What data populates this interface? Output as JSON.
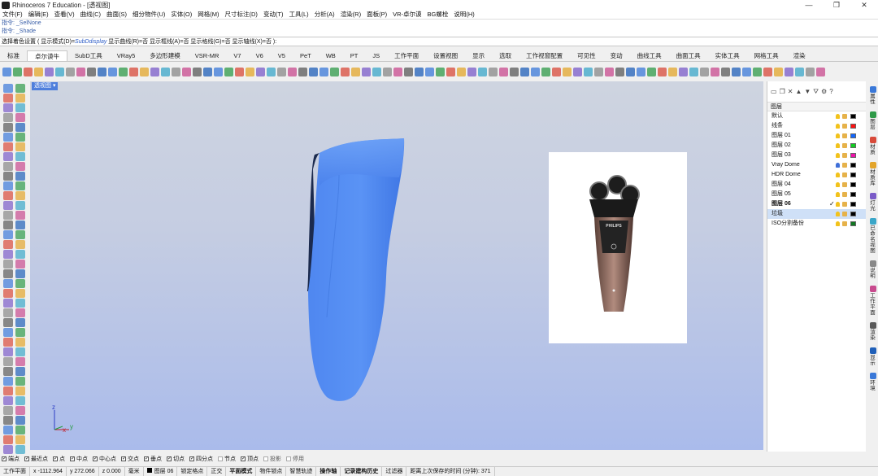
{
  "window": {
    "title": "Rhinoceros 7 Education - [透视图]",
    "minimize": "—",
    "maximize": "❐",
    "close": "✕"
  },
  "menu": [
    "文件(F)",
    "编辑(E)",
    "查看(V)",
    "曲线(C)",
    "曲面(S)",
    "细分物件(U)",
    "实体(O)",
    "网格(M)",
    "尺寸标注(D)",
    "变动(T)",
    "工具(L)",
    "分析(A)",
    "渲染(R)",
    "面板(P)",
    "VR-卓尔谟",
    "BG螺栓",
    "说明(H)"
  ],
  "command_history": [
    "指令: _SelNone",
    "指令: _Shade"
  ],
  "command_prompt": {
    "prefix": "选择着色设置 ( 显示模式(D)=",
    "mode": "SubDdisplay",
    "rest": " 显示曲线(R)=否 显示框线(A)=否 显示格线(G)=否 显示轴线(X)=否 ):"
  },
  "tabs": [
    "标准",
    "卓尔谟牛",
    "SubD工具",
    "VRay5",
    "多边形建模",
    "VSR-MR",
    "V7",
    "V6",
    "V5",
    "PeT",
    "WB",
    "PT",
    "JS",
    "工作平面",
    "设置视图",
    "显示",
    "选取",
    "工作视窗配置",
    "可见性",
    "变动",
    "曲线工具",
    "曲面工具",
    "实体工具",
    "网格工具",
    "渲染"
  ],
  "active_tab": "卓尔谟牛",
  "viewport": {
    "label": "透视图 ▾",
    "axis_x": "x",
    "axis_y": "y",
    "axis_z": "z"
  },
  "reference_image": {
    "brand": "PHILIPS"
  },
  "layers_panel": {
    "header": "图层",
    "toolbar_icons": [
      "new-layer-icon",
      "copy-icon",
      "delete-icon",
      "up-icon",
      "down-icon",
      "filter-icon",
      "tools-icon",
      "help-icon"
    ],
    "rows": [
      {
        "name": "默认",
        "color": "#000000",
        "bold": false,
        "selected": false,
        "current": false,
        "bulb": "#f2c21b"
      },
      {
        "name": "线条",
        "color": "#ff1111",
        "bold": false,
        "selected": false,
        "current": false,
        "bulb": "#f2c21b"
      },
      {
        "name": "图层 01",
        "color": "#1166ff",
        "bold": false,
        "selected": false,
        "current": false,
        "bulb": "#f2c21b"
      },
      {
        "name": "图层 02",
        "color": "#11cc22",
        "bold": false,
        "selected": false,
        "current": false,
        "bulb": "#f2c21b"
      },
      {
        "name": "图层 03",
        "color": "#ee11aa",
        "bold": false,
        "selected": false,
        "current": false,
        "bulb": "#f2c21b"
      },
      {
        "name": "Vray Dome",
        "color": "#000000",
        "bold": false,
        "selected": false,
        "current": false,
        "bulb": "#3f6fd8"
      },
      {
        "name": "HDR Dome",
        "color": "#000000",
        "bold": false,
        "selected": false,
        "current": false,
        "bulb": "#f2c21b"
      },
      {
        "name": "图层 04",
        "color": "#000000",
        "bold": false,
        "selected": false,
        "current": false,
        "bulb": "#f2c21b"
      },
      {
        "name": "图层 05",
        "color": "#000000",
        "bold": false,
        "selected": false,
        "current": false,
        "bulb": "#f2c21b"
      },
      {
        "name": "图层 06",
        "color": "#000000",
        "bold": true,
        "selected": false,
        "current": true,
        "bulb": "#f2c21b"
      },
      {
        "name": "垃圾",
        "color": "#000000",
        "bold": false,
        "selected": true,
        "current": false,
        "bulb": "#f2c21b"
      },
      {
        "name": "ISO分割备份",
        "color": "#117722",
        "bold": false,
        "selected": false,
        "current": false,
        "bulb": "#f2c21b"
      }
    ]
  },
  "side_tabs": [
    "属性",
    "图层",
    "材质",
    "材质库",
    "灯光",
    "已命名视图",
    "说明",
    "工作平面",
    "渲染",
    "显示",
    "环境"
  ],
  "osnap": [
    {
      "label": "端点",
      "checked": true
    },
    {
      "label": "最近点",
      "checked": true
    },
    {
      "label": "点",
      "checked": true
    },
    {
      "label": "中点",
      "checked": true
    },
    {
      "label": "中心点",
      "checked": true
    },
    {
      "label": "交点",
      "checked": true
    },
    {
      "label": "垂点",
      "checked": true
    },
    {
      "label": "切点",
      "checked": true
    },
    {
      "label": "四分点",
      "checked": true
    },
    {
      "label": "节点",
      "checked": false
    },
    {
      "label": "顶点",
      "checked": true
    },
    {
      "label": "投影",
      "checked": false
    },
    {
      "label": "停用",
      "checked": false
    }
  ],
  "status": {
    "plane": "工作平面",
    "x": "x -1112.964",
    "y": "y 272.066",
    "z": "z 0.000",
    "units": "毫米",
    "layer": "图层 06",
    "toggles": [
      "锁定格点",
      "正交",
      "平面模式",
      "物件锁点",
      "智慧轨迹",
      "操作轴",
      "记录建构历史",
      "过滤器"
    ],
    "bold_toggles": [
      "平面模式",
      "操作轴",
      "记录建构历史"
    ],
    "autosave": "距离上次保存的时间 (分钟): 371"
  },
  "colors": {
    "model_blue": "#4f87f0",
    "model_dark": "#1b2a4e",
    "accent": "#4f7fdc"
  }
}
